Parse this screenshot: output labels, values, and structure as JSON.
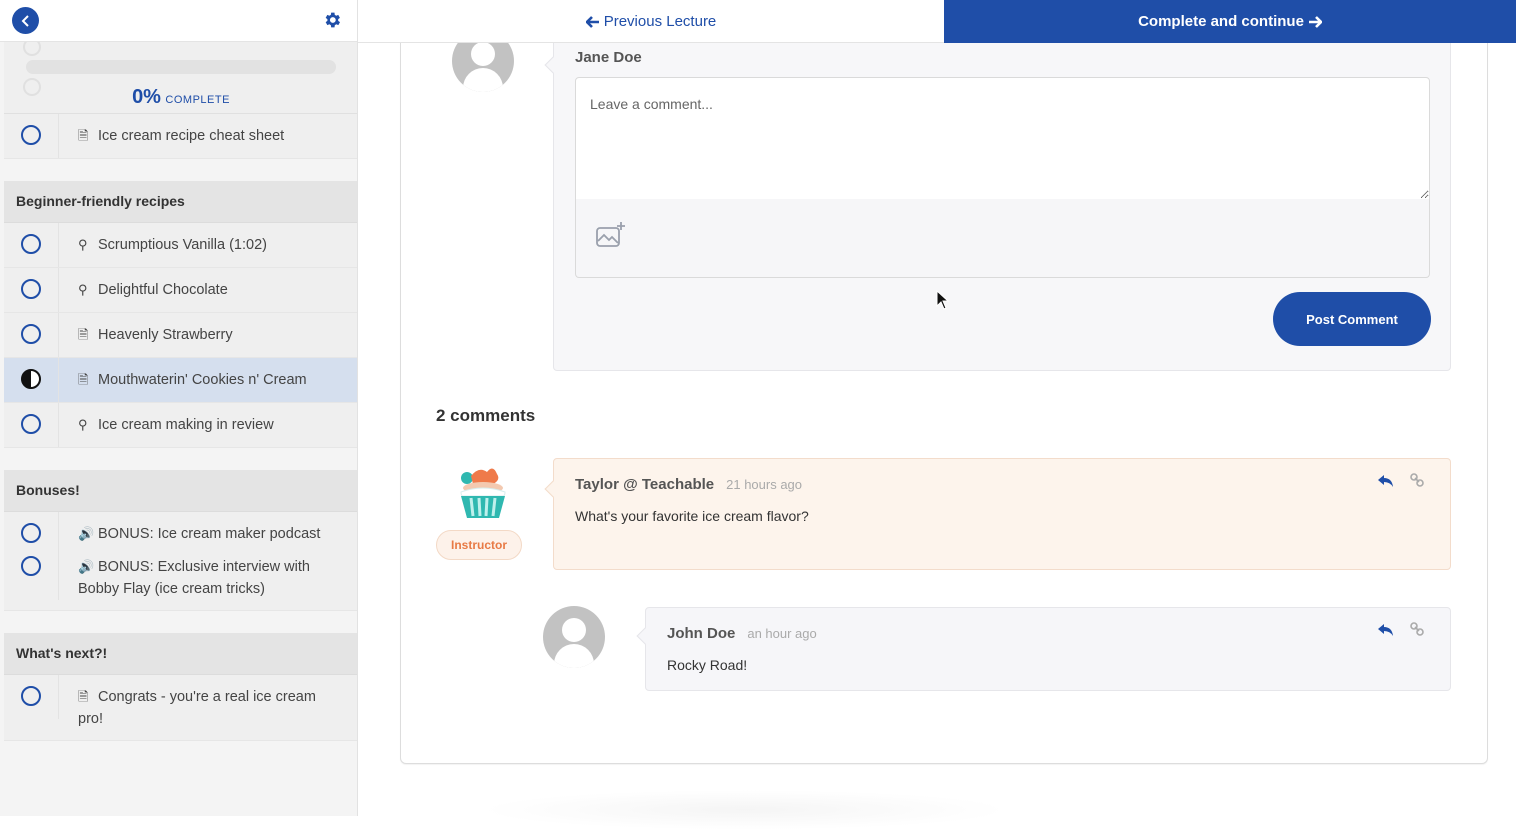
{
  "sidebar": {
    "back_icon": "chevron-left-icon",
    "settings_icon": "gear-icon",
    "progress": {
      "percent_label": "0%",
      "complete_label": "COMPLETE",
      "fraction": 0
    },
    "top_lesson": {
      "title": "Ice cream recipe cheat sheet",
      "type": "document"
    },
    "sections": [
      {
        "title": "Beginner-friendly recipes",
        "lessons": [
          {
            "title": "Scrumptious Vanilla (1:02)",
            "type": "quiz-bulb",
            "status": "incomplete"
          },
          {
            "title": "Delightful Chocolate",
            "type": "quiz-bulb",
            "status": "incomplete"
          },
          {
            "title": "Heavenly Strawberry",
            "type": "document",
            "status": "incomplete"
          },
          {
            "title": "Mouthwaterin' Cookies n' Cream",
            "type": "document",
            "status": "in-progress"
          },
          {
            "title": "Ice cream making in review",
            "type": "quiz-bulb",
            "status": "incomplete"
          }
        ]
      },
      {
        "title": "Bonuses!",
        "lessons": [
          {
            "title": "BONUS: Ice cream maker podcast",
            "type": "audio",
            "status": "incomplete"
          },
          {
            "title": "BONUS: Exclusive interview with Bobby Flay (ice cream tricks)",
            "type": "audio",
            "status": "incomplete"
          }
        ]
      },
      {
        "title": "What's next?!",
        "lessons": [
          {
            "title": "Congrats - you're a real ice cream pro!",
            "type": "document",
            "status": "incomplete"
          }
        ]
      }
    ]
  },
  "nav": {
    "previous_label": "Previous Lecture",
    "next_label": "Complete and continue"
  },
  "composer": {
    "author": "Jane Doe",
    "placeholder": "Leave a comment...",
    "value": "",
    "image_icon": "image-add-icon",
    "post_label": "Post Comment"
  },
  "comments": {
    "count_label": "2 comments",
    "items": [
      {
        "author": "Taylor @ Teachable",
        "time": "21 hours ago",
        "body": "What's your favorite ice cream flavor?",
        "badge": "Instructor"
      },
      {
        "author": "John Doe",
        "time": "an hour ago",
        "body": "Rocky Road!"
      }
    ]
  },
  "colors": {
    "brand": "#1f4ea8",
    "instructor_bg": "#fdf4ec",
    "instructor_accent": "#e87a45"
  }
}
